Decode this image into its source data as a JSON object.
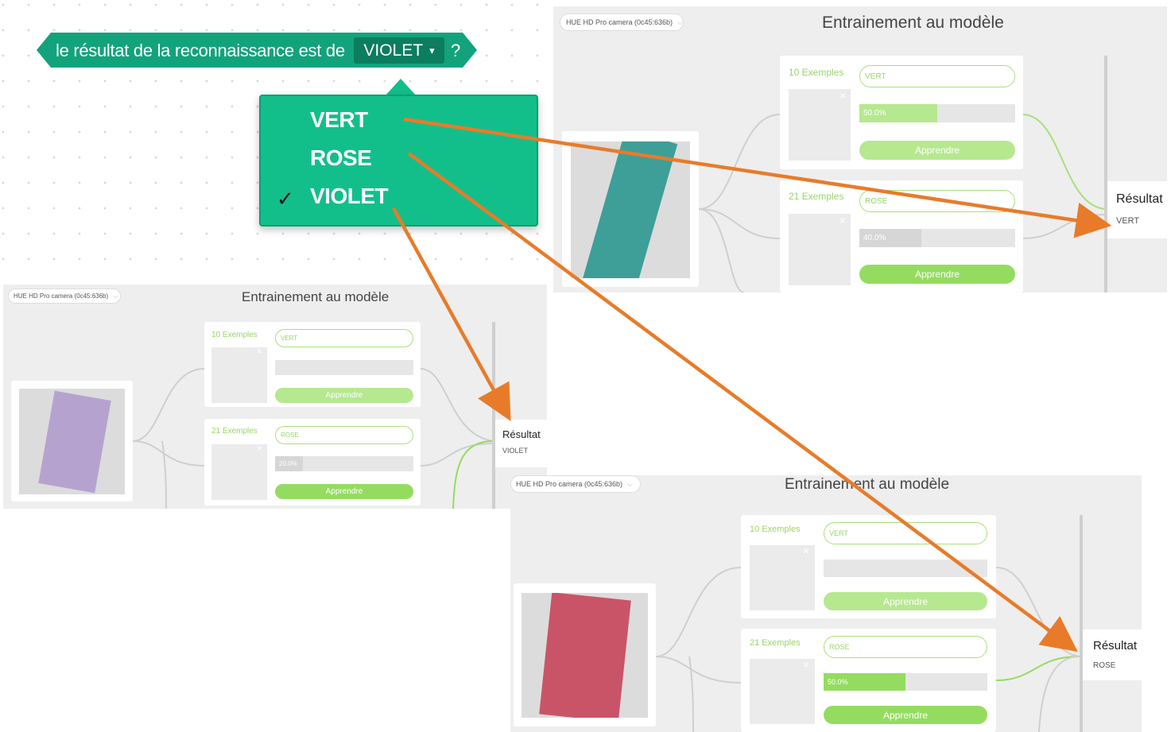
{
  "block": {
    "text": "le résultat de la reconnaissance est de",
    "dropdown_value": "VIOLET",
    "dropdown_caret": "▾",
    "suffix": "?"
  },
  "menu": {
    "items": [
      {
        "label": "VERT",
        "checked": false
      },
      {
        "label": "ROSE",
        "checked": false
      },
      {
        "label": "VIOLET",
        "checked": true
      }
    ],
    "check_glyph": "✓"
  },
  "panels": [
    {
      "camera": "HUE HD Pro camera (0c45:636b)",
      "title": "Entrainement au modèle",
      "classes": [
        {
          "examples": "10 Exemples",
          "label": "VERT",
          "confidence": "50.0%",
          "confidence_value": 0.5,
          "button": "Apprendre"
        },
        {
          "examples": "21 Exemples",
          "label": "ROSE",
          "confidence": "40.0%",
          "confidence_value": 0.4,
          "button": "Apprendre"
        }
      ],
      "result_title": "Résultat",
      "result_value": "VERT",
      "paper_color": "#3d9f98"
    },
    {
      "camera": "HUE HD Pro camera (0c45:636b)",
      "title": "Entrainement au modèle",
      "classes": [
        {
          "examples": "10 Exemples",
          "label": "VERT",
          "confidence": "",
          "confidence_value": 0.0,
          "button": "Apprendre"
        },
        {
          "examples": "21 Exemples",
          "label": "ROSE",
          "confidence": "20.0%",
          "confidence_value": 0.2,
          "button": "Apprendre"
        }
      ],
      "result_title": "Résultat",
      "result_value": "VIOLET",
      "paper_color": "#b6a2cf"
    },
    {
      "camera": "HUE HD Pro camera (0c45:636b)",
      "title": "Entrainement au modèle",
      "classes": [
        {
          "examples": "10 Exemples",
          "label": "VERT",
          "confidence": "",
          "confidence_value": 0.0,
          "button": "Apprendre"
        },
        {
          "examples": "21 Exemples",
          "label": "ROSE",
          "confidence": "50.0%",
          "confidence_value": 0.5,
          "button": "Apprendre"
        }
      ],
      "result_title": "Résultat",
      "result_value": "ROSE",
      "paper_color": "#c95468"
    }
  ],
  "colors": {
    "block_green": "#12a37c",
    "menu_green": "#12bf8b",
    "accent_green": "#9bd46b",
    "arrow_orange": "#e87b2a"
  },
  "icons": {
    "remove": "×",
    "chevron": "⌵"
  }
}
